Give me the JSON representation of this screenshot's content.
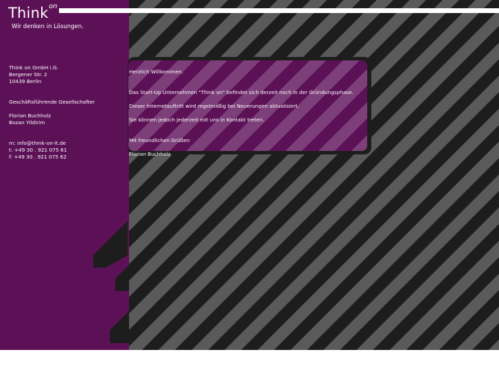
{
  "brand": {
    "name": "Think",
    "superscript": "on",
    "tagline": "Wir denken in Lösungen."
  },
  "company": {
    "name": "Think on GmbH i.G.",
    "street": "Bergener Str. 2",
    "city": "10439 Berlin"
  },
  "management": {
    "heading": "Geschäftsführende Gesellschafter",
    "members": [
      "Florian Buchholz",
      "Bozan Yildirim"
    ]
  },
  "contact": {
    "email": "m:  info@think-on-it.de",
    "phone": "t:  +49 30 . 921 075 61",
    "fax": "f:  +49 30 . 921 075 62"
  },
  "message": {
    "greeting": "Herzlich Willkommen.",
    "line1": "Das Start-Up Unternehmen \"Think on\" befindet sich derzeit noch in der Gründungsphase.",
    "line2": "Dieser Internetauftritt wird regelmäßig bei Neuerungen aktualisiert.",
    "line3": "Sie können jedoch jederzeit mit uns in Kontakt treten.",
    "closing": "Mit freundlichen Grüßen",
    "signature": "Florian Buchholz"
  },
  "colors": {
    "purple": "#5c1157",
    "stripe_dark": "#1d1d1d",
    "stripe_light": "#5a5a5a",
    "white": "#ffffff"
  }
}
